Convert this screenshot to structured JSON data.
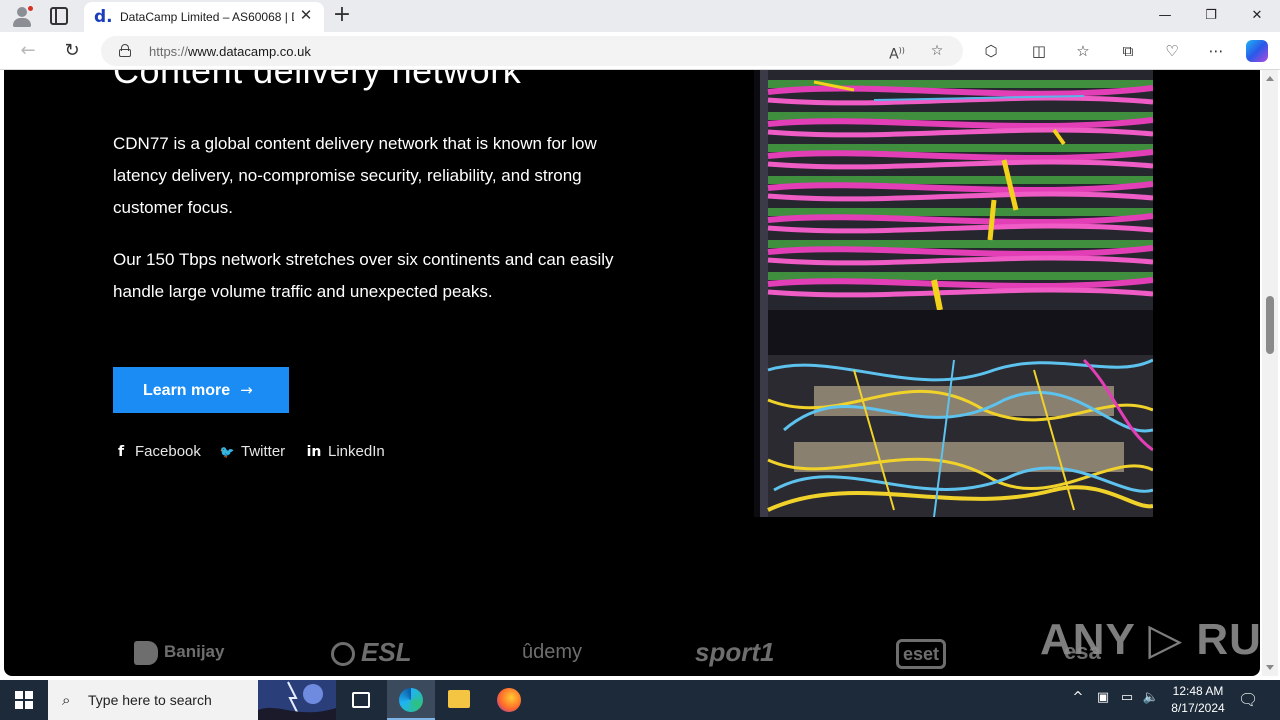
{
  "browser": {
    "tab_title": "DataCamp Limited – AS60068 | D",
    "favicon_letter": "d.",
    "url_protocol": "https://",
    "url_host": "www.datacamp.co.uk",
    "new_tab_glyph": "+",
    "close_tab_glyph": "✕"
  },
  "window_controls": {
    "minimize": "—",
    "restore": "❐",
    "close": "✕"
  },
  "page": {
    "heading": "Content delivery network",
    "paragraph1": "CDN77 is a global content delivery network that is known for low latency delivery, no-compromise security, reliability, and strong customer focus.",
    "paragraph2": "Our 150 Tbps network stretches over six continents and can easily handle large volume traffic and unexpected peaks.",
    "cta_label": "Learn more",
    "cta_arrow": "→",
    "social": [
      {
        "icon": "facebook-icon",
        "glyph": "f",
        "label": "Facebook"
      },
      {
        "icon": "twitter-icon",
        "glyph": "🐦",
        "label": "Twitter"
      },
      {
        "icon": "linkedin-icon",
        "glyph": "in",
        "label": "LinkedIn"
      }
    ],
    "client_logos": [
      "Banijay",
      "ESL",
      "ûdemy",
      "sport1",
      "eset",
      "esa"
    ]
  },
  "watermark": "ANY ▷ RUN",
  "taskbar": {
    "search_placeholder": "Type here to search",
    "time": "12:48 AM",
    "date": "8/17/2024"
  },
  "colors": {
    "accent_button": "#1a8cf3",
    "page_background": "#000000",
    "favicon_blue": "#1a3dbb"
  }
}
